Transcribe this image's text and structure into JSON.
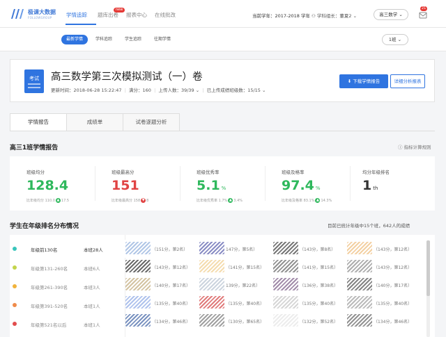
{
  "header": {
    "brand": "极课大数据",
    "brand_sub": "FOLLOWGROUP",
    "nav": [
      "学情追踪",
      "题库出卷",
      "报表中心",
      "在线批改"
    ],
    "new_badge": "new",
    "term": "当前学年：2017-2018 学年",
    "user": "学科组长：董夏2",
    "grade_select": "高三数学",
    "notice_count": "21"
  },
  "subnav": {
    "pills": [
      "最新学情",
      "学科追踪",
      "学生追踪",
      "往期学情"
    ],
    "class_select": "1班"
  },
  "exam": {
    "icon_label": "考试",
    "title": "高三数学第三次模拟测试（一）卷",
    "updated": "更新时间：2018-06-28 15:22:47",
    "full_score": "满分：160",
    "participants": "上传人数：39/39",
    "classes": "已上传成绩班级数：15/15",
    "download_btn": "下载学情报告",
    "detail_btn": "详细分析报表"
  },
  "tabs": [
    "学情报告",
    "成绩单",
    "试卷逐题分析"
  ],
  "report": {
    "title": "高三1班学情报告",
    "calc_rule": "指标计算规则",
    "stats": [
      {
        "label": "班级均分",
        "value": "128.4",
        "unit": "",
        "color": "#2eb85c",
        "cmp": "比年级均分 110.0",
        "delta": "17.5",
        "dir": "up"
      },
      {
        "label": "班级最高分",
        "value": "151",
        "unit": "",
        "color": "#e04343",
        "cmp": "比年级最高分 158",
        "delta": "8",
        "dir": "down"
      },
      {
        "label": "班级优秀率",
        "value": "5.1",
        "unit": "%",
        "color": "#2eb85c",
        "cmp": "比年级优秀率 1.7%",
        "delta": "3.4%",
        "dir": "up"
      },
      {
        "label": "班级及格率",
        "value": "97.4",
        "unit": "%",
        "color": "#2eb85c",
        "cmp": "比年级及格率 83.1%",
        "delta": "14.3%",
        "dir": "up"
      },
      {
        "label": "均分年级排名",
        "value": "1",
        "unit": "th",
        "color": "#333333",
        "cmp": "",
        "delta": "",
        "dir": ""
      }
    ]
  },
  "distribution": {
    "title": "学生在年级排名分布情况",
    "note": "目前已统计年级中15个班，642人的成绩",
    "bands": [
      {
        "name": "年级前130名",
        "count": "本班28人",
        "color": "#39c5bb"
      },
      {
        "name": "年级第131-260名",
        "count": "本班6人",
        "color": "#c3d44b"
      },
      {
        "name": "年级第261-390名",
        "count": "本班3人",
        "color": "#f1b33b"
      },
      {
        "name": "年级第391-520名",
        "count": "本班1人",
        "color": "#ef8b4a"
      },
      {
        "name": "年级第521名以后",
        "count": "本班1人",
        "color": "#e24d4d"
      }
    ],
    "students": [
      [
        "（151分，第2名）",
        "147分，第5名）",
        "（143分，第8名）",
        "（143分，第12名）"
      ],
      [
        "（143分，第12名）",
        "（141分，第15名）",
        "（141分，第15名）",
        "（143分，第12名）"
      ],
      [
        "（140分，第17名）",
        "139分，第22名）",
        "（136分，第38名）",
        "（140分，第17名）"
      ],
      [
        "（135分，第40名）",
        "（135分，第40名）",
        "（135分，第40名）",
        "（135分，第40名）"
      ],
      [
        "（134分，第46名）",
        "（130分，第65名）",
        "（132分，第52名）",
        "（134分，第46名）"
      ]
    ],
    "sig_colors": [
      [
        "#9db8e0",
        "#6b6fb5",
        "#555555",
        "#f0c48a"
      ],
      [
        "#444444",
        "#f2d39a",
        "#777777",
        "#999999"
      ],
      [
        "#c8b48a",
        "#bfc9d6",
        "#8a6f94",
        "#666666"
      ],
      [
        "#9bb3e8",
        "#d95b5b",
        "#cccccc",
        "#aaaaaa"
      ],
      [
        "#5877b0",
        "#888888",
        "#e8e8e8",
        "#777777"
      ]
    ]
  }
}
